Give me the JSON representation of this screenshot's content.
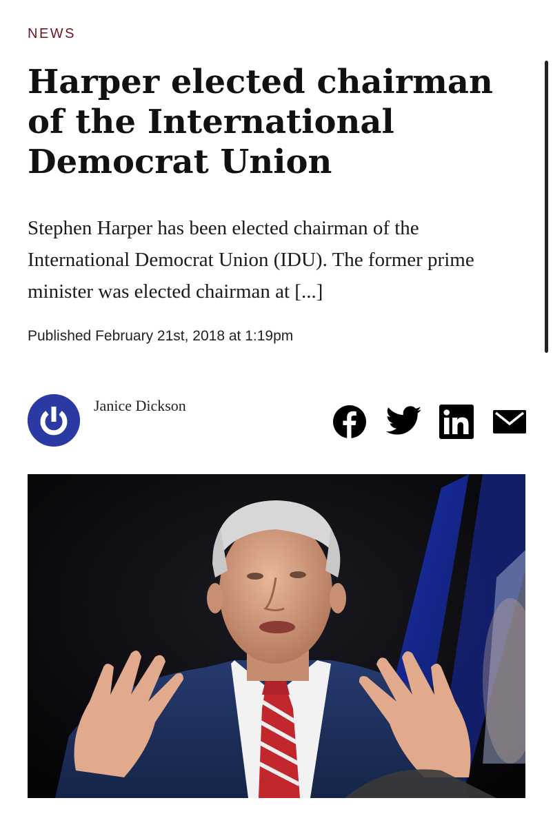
{
  "article": {
    "section": "NEWS",
    "headline": "Harper elected chairman of the International Democrat Union",
    "excerpt": "Stephen Harper has been elected chairman of the International Democrat Union (IDU). The former prime minister was elected chairman at [...]",
    "published": "Published February 21st, 2018 at 1:19pm"
  },
  "author": {
    "name": "Janice Dickson",
    "avatar_icon": "power-logo-icon",
    "avatar_color": "#2b3aa3"
  },
  "share": {
    "icons": [
      "facebook-icon",
      "twitter-icon",
      "linkedin-icon",
      "email-icon"
    ]
  },
  "colors": {
    "section": "#6b1620",
    "text": "#111111"
  }
}
